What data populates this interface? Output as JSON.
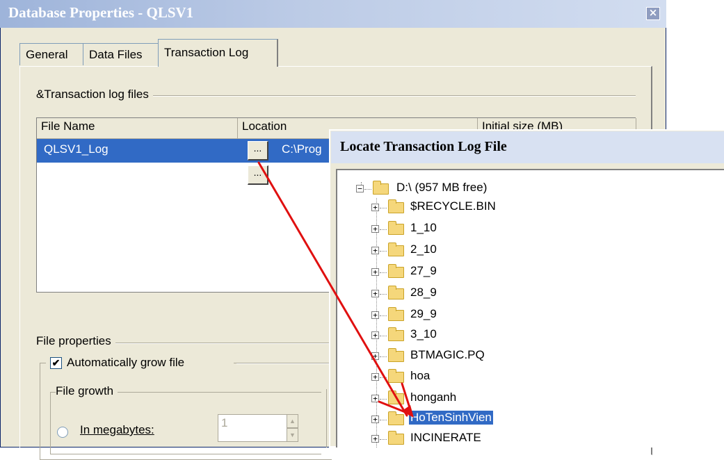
{
  "window": {
    "title": "Database Properties - QLSV1",
    "close_glyph": "×"
  },
  "tabs": [
    {
      "label": "General"
    },
    {
      "label": "Data Files"
    },
    {
      "label": "Transaction Log",
      "active": true
    }
  ],
  "log_files_group": {
    "title": "&Transaction log files",
    "columns": [
      "File Name",
      "Location",
      "Initial size (MB)"
    ],
    "rows": [
      {
        "file_name": "QLSV1_Log",
        "location": "C:\\Prog",
        "browse": "..."
      },
      {
        "file_name": "",
        "location": "",
        "browse": "..."
      }
    ]
  },
  "file_properties": {
    "title": "File properties",
    "auto_grow_label": "Automatically grow file",
    "auto_grow_checked": true,
    "file_growth_title": "File growth",
    "in_megabytes_label": "In megabytes:",
    "in_megabytes_value": "1"
  },
  "locate_dialog": {
    "title": "Locate Transaction Log File",
    "root": {
      "label": "D:\\ (957 MB free)",
      "expanded": true
    },
    "folders": [
      {
        "label": "$RECYCLE.BIN"
      },
      {
        "label": "1_10"
      },
      {
        "label": "2_10"
      },
      {
        "label": "27_9"
      },
      {
        "label": "28_9"
      },
      {
        "label": "29_9"
      },
      {
        "label": "3_10"
      },
      {
        "label": "BTMAGIC.PQ"
      },
      {
        "label": "hoa"
      },
      {
        "label": "honganh"
      },
      {
        "label": "HoTenSinhVien",
        "selected": true
      },
      {
        "label": "INCINERATE"
      }
    ]
  },
  "annotation_color": "#E01010"
}
